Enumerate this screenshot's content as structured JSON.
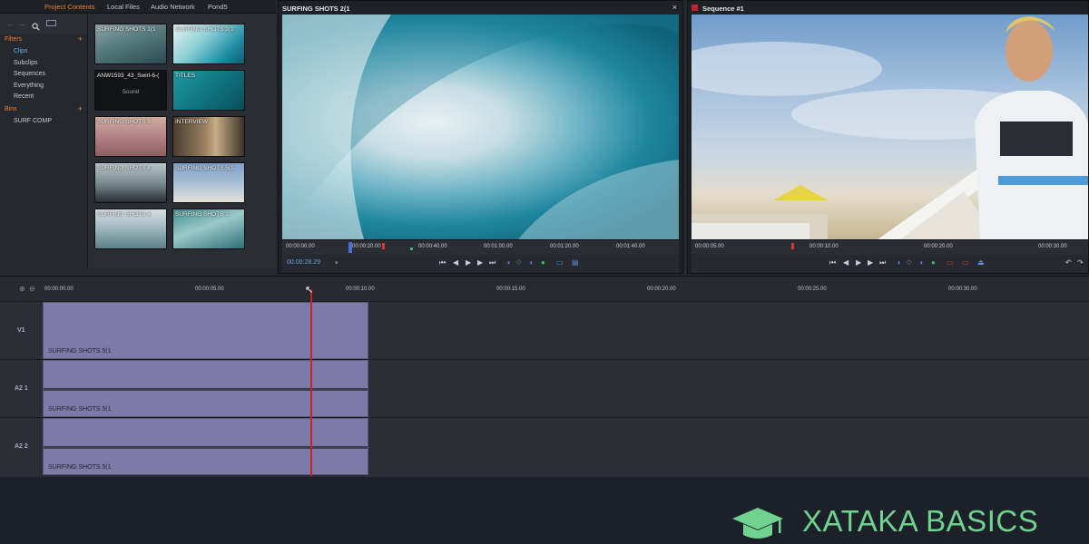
{
  "tabs": [
    "Project Contents",
    "Local Files",
    "Audio Network",
    "Pond5"
  ],
  "sidebar": {
    "filters_heading": "Filters",
    "filters": [
      "Clips",
      "Subclips",
      "Sequences",
      "Everything",
      "Recent"
    ],
    "bins_heading": "Bins",
    "bins": [
      "SURF COMP"
    ]
  },
  "clips": [
    {
      "label": "SURFING SHOTS 1(1",
      "sub": ""
    },
    {
      "label": "SURFING SHOTS 2(1",
      "sub": ""
    },
    {
      "label": "ANW1593_43_Swirl-6-(",
      "sub": "Sound"
    },
    {
      "label": "TITLES",
      "sub": ""
    },
    {
      "label": "SURFING SHOTS 6",
      "sub": ""
    },
    {
      "label": "INTERVIEW",
      "sub": ""
    },
    {
      "label": "SURFING SHOTS 4",
      "sub": ""
    },
    {
      "label": "SURFING SHOTS 5(1",
      "sub": ""
    },
    {
      "label": "SURFING SHOTS 4",
      "sub": ""
    },
    {
      "label": "SURFING SHOTS 3",
      "sub": ""
    }
  ],
  "source_viewer": {
    "title": "SURFING SHOTS 2(1",
    "close": "×",
    "ruler": [
      "00:00:00.00",
      "00:00:20.00",
      "00:00:40.00",
      "00:01:00.00",
      "00:01:20.00",
      "00:01:40.00"
    ],
    "timecode": "00:00:28.29",
    "timecode_arrow": "▾"
  },
  "record_viewer": {
    "title": "Sequence #1",
    "ruler": [
      "00:00:05.00",
      "00:00:10.00",
      "00:00:15.00",
      "00:00:20.00",
      "00:00:25.00",
      "00:00:30.00"
    ]
  },
  "timeline": {
    "ruler": [
      "00:00:00.00",
      "00:00:05.00",
      "00:00:10.00",
      "00:00:15.00",
      "00:00:20.00",
      "00:00:25.00",
      "00:00:30.00"
    ],
    "tracks": [
      {
        "name": "V1",
        "clip": "SURFING SHOTS 5(1"
      },
      {
        "name": "A2 1",
        "clip": "SURFING SHOTS 5(1"
      },
      {
        "name": "A2 2",
        "clip": "SURFING SHOTS 5(1"
      }
    ]
  },
  "brand": "XATAKA BASICS",
  "colors": {
    "accent": "#ef7f2b",
    "brand": "#6fd28f",
    "clip": "#7d7aa8",
    "playhead": "#c4232e"
  }
}
